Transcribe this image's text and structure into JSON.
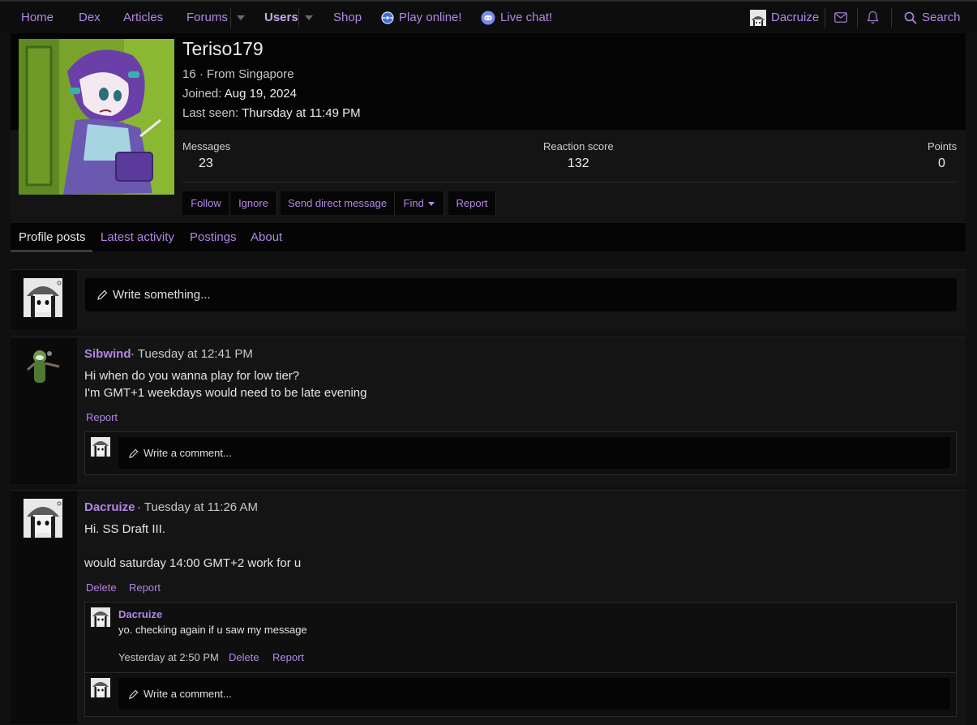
{
  "nav": {
    "home": "Home",
    "dex": "Dex",
    "articles": "Articles",
    "forums": "Forums",
    "users": "Users",
    "shop": "Shop",
    "play_online": "Play online!",
    "live_chat": "Live chat!",
    "account_name": "Dacruize",
    "search": "Search"
  },
  "profile": {
    "username": "Teriso179",
    "age_location": "16 · From Singapore",
    "joined_label": "Joined:",
    "joined_value": "Aug 19, 2024",
    "last_seen_label": "Last seen:",
    "last_seen_value": "Thursday at 11:49 PM",
    "stats": {
      "messages_label": "Messages",
      "messages_value": "23",
      "reaction_label": "Reaction score",
      "reaction_value": "132",
      "points_label": "Points",
      "points_value": "0"
    },
    "buttons": {
      "follow": "Follow",
      "ignore": "Ignore",
      "send_dm": "Send direct message",
      "find": "Find",
      "report": "Report"
    }
  },
  "tabs": {
    "profile_posts": "Profile posts",
    "latest_activity": "Latest activity",
    "postings": "Postings",
    "about": "About"
  },
  "composer": {
    "placeholder": "Write something..."
  },
  "posts": [
    {
      "author": "Sibwind",
      "date": "· Tuesday at 12:41 PM",
      "line1": "Hi when do you wanna play for low tier?",
      "line2": "I'm GMT+1 weekdays would need to be late evening",
      "report": "Report",
      "comment_placeholder": "Write a comment..."
    },
    {
      "author": "Dacruize",
      "date": "· Tuesday at 11:26 AM",
      "line1": "Hi. SS Draft III.",
      "line2": "would saturday 14:00 GMT+2 work for u",
      "delete": "Delete",
      "report": "Report",
      "reply": {
        "author": "Dacruize",
        "text": "yo. checking again if u saw my message",
        "date": "Yesterday at 2:50 PM",
        "delete": "Delete",
        "report": "Report"
      },
      "comment_placeholder": "Write a comment..."
    }
  ],
  "colors": {
    "accent": "#b486e8",
    "background": "#101010"
  }
}
